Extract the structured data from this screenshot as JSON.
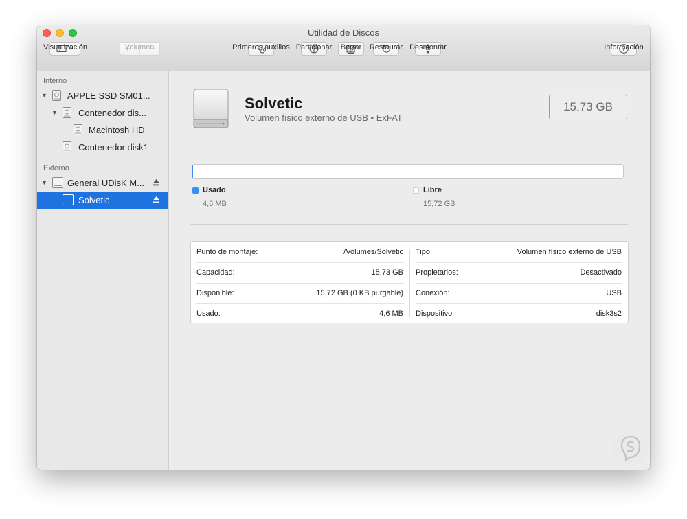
{
  "window": {
    "title": "Utilidad de Discos"
  },
  "toolbar": {
    "view_label": "Visualización",
    "volume_label": "Volumen",
    "first_aid_label": "Primeros auxilios",
    "partition_label": "Particionar",
    "erase_label": "Borrar",
    "restore_label": "Restaurar",
    "unmount_label": "Desmontar",
    "info_label": "Información",
    "volume_add_symbol": "+",
    "volume_remove_symbol": "−"
  },
  "sidebar": {
    "internal_header": "Interno",
    "external_header": "Externo",
    "items": [
      {
        "label": "APPLE SSD SM01...",
        "icon": "internal-disk-icon"
      },
      {
        "label": "Contenedor dis...",
        "icon": "container-disk-icon"
      },
      {
        "label": "Macintosh HD",
        "icon": "volume-disk-icon"
      },
      {
        "label": "Contenedor disk1",
        "icon": "container-disk-icon"
      },
      {
        "label": "General UDisK M...",
        "icon": "external-disk-icon"
      },
      {
        "label": "Solvetic",
        "icon": "volume-disk-icon"
      }
    ]
  },
  "detail": {
    "name": "Solvetic",
    "subtitle": "Volumen físico externo de USB • ExFAT",
    "size": "15,73 GB",
    "used_fraction": 0.0003,
    "legend": {
      "used_label": "Usado",
      "used_value": "4,6 MB",
      "free_label": "Libre",
      "free_value": "15,72 GB"
    }
  },
  "info": {
    "left": [
      {
        "label": "Punto de montaje:",
        "value": "/Volumes/Solvetic"
      },
      {
        "label": "Capacidad:",
        "value": "15,73 GB"
      },
      {
        "label": "Disponible:",
        "value": "15,72 GB (0 KB purgable)"
      },
      {
        "label": "Usado:",
        "value": "4,6 MB"
      }
    ],
    "right": [
      {
        "label": "Tipo:",
        "value": "Volumen físico externo de USB"
      },
      {
        "label": "Propietarios:",
        "value": "Desactivado"
      },
      {
        "label": "Conexión:",
        "value": "USB"
      },
      {
        "label": "Dispositivo:",
        "value": "disk3s2"
      }
    ]
  },
  "colors": {
    "accent": "#1f73e0",
    "used": "#3b8ff0",
    "free": "#ffffff",
    "close": "#fe5f57",
    "minimize": "#febc2e",
    "maximize": "#28c840"
  }
}
